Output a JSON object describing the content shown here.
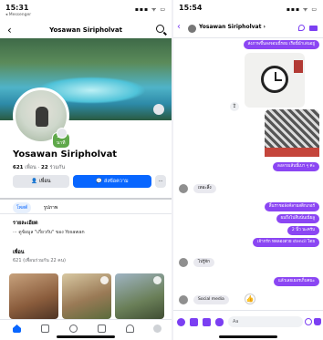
{
  "left": {
    "status": {
      "time": "15:31",
      "sub": "◂ Messenger",
      "sys": "▪▪▪ ᯤ ▭"
    },
    "header": {
      "back": "‹",
      "title": "Yosawan Siripholvat"
    },
    "story_label": "18 นาที",
    "name": "Yosawan Siripholvat",
    "stats": {
      "friends_count": "621",
      "friends_word": " เพื่อน · ",
      "mutual_count": "22",
      "mutual_word": " ร่วมกัน"
    },
    "buttons": {
      "friend": "👤 เพื่อน",
      "message": "💬 ส่งข้อความ",
      "more": "···"
    },
    "tabs": [
      "โพสต์",
      "รูปภาพ"
    ],
    "details": {
      "title": "รายละเอียด",
      "line": "··· ดูข้อมูล \"เกี่ยวกับ\" ของ Yosawan"
    },
    "friends": {
      "title": "เพื่อน",
      "count": "621 (เพื่อนร่วมกัน 22 คน)"
    }
  },
  "right": {
    "status": {
      "time": "15:54",
      "sys": "▪▪▪ ᯤ ▭"
    },
    "header": {
      "back": "‹",
      "name": "Yosawan Siripholvat ›"
    },
    "messages": {
      "m1": "ส่งภาพขึ้นลงจอนนี้รอบ เรือนี้นำเล่นอยู่",
      "m2": "ลงลายเส้นนี้เบา ๆ ค่ะ",
      "m3": "เทอะลิ้ง",
      "m4": "ลิ้นราชอลังค์ลายสติกเกอร์",
      "m5": "ผมถึงไปสืบนั่นเนี่ยลู",
      "m6": "2 นิ้ว นะครับ",
      "m7": "เจ้ากรัก ทดลองสวย stencil โดย",
      "m8": "ไปรู้จัก",
      "m9": "แล้วเลยเยอรเก็บคนะ",
      "m10": "Social media",
      "m10b": "👍"
    },
    "composer": {
      "placeholder": "Aa"
    }
  }
}
